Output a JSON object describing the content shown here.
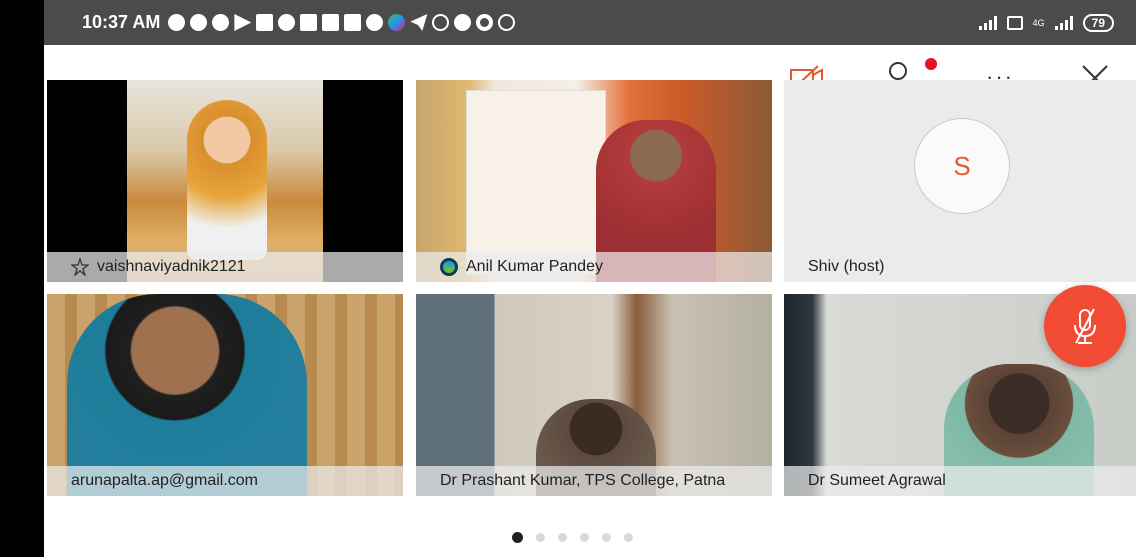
{
  "status_bar": {
    "time": "10:37 AM",
    "network_label": "4G",
    "battery": "79",
    "notification_icons": [
      "app-icon",
      "app-icon",
      "app-icon",
      "play-icon",
      "gallery-icon",
      "facebook-icon",
      "calendar-icon",
      "mail-icon",
      "mail-icon",
      "shield-icon",
      "multicolor-icon",
      "telegram-icon",
      "whatsapp-icon",
      "phone-icon",
      "camera-icon",
      "clock-icon"
    ]
  },
  "toolbar": {
    "video_off_icon": "video-off-icon",
    "participants_icon": "participants-icon",
    "more_label": "···",
    "close_icon": "close-icon",
    "notification_color": "#e81123"
  },
  "participants": [
    {
      "name": "vaishnaviyadnik2121",
      "badge_icon": "star-icon",
      "active": true
    },
    {
      "name": "Anil Kumar Pandey",
      "badge_icon": "webex-icon",
      "active": false
    },
    {
      "name": "Shiv (host)",
      "avatar_letter": "S",
      "active": false
    },
    {
      "name": "arunapalta.ap@gmail.com",
      "active": false
    },
    {
      "name": "Dr Prashant Kumar, TPS College, Patna",
      "active": false
    },
    {
      "name": "Dr Sumeet Agrawal",
      "active": false
    }
  ],
  "mic_button": {
    "icon": "mic-muted-icon",
    "color": "#f24b33"
  },
  "pagination": {
    "pages": 6,
    "current": 1
  },
  "colors": {
    "accent": "#e8582c",
    "active_outline": "#a9d2ec"
  }
}
